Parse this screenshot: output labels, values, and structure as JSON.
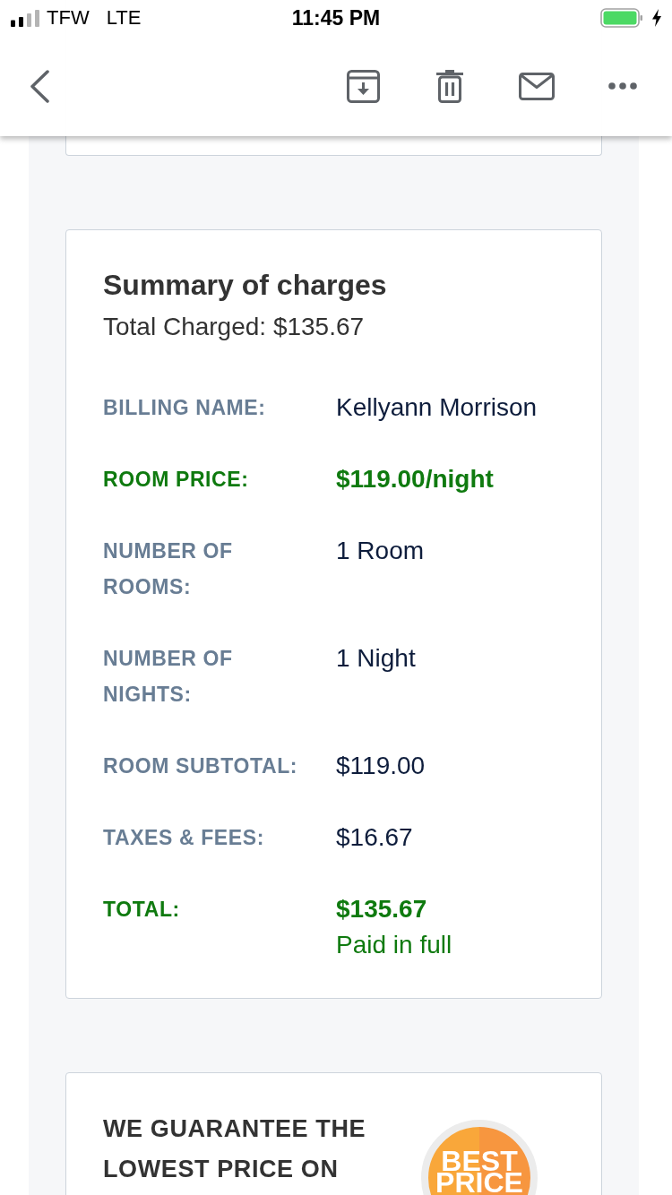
{
  "status_bar": {
    "carrier": "TFW",
    "network": "LTE",
    "time": "11:45 PM",
    "charging": true
  },
  "summary": {
    "title": "Summary of charges",
    "total_charged": "Total Charged: $135.67",
    "rows": [
      {
        "kind": "plain",
        "label": "BILLING NAME:",
        "value": "Kellyann Morrison"
      },
      {
        "kind": "highlight",
        "label": "ROOM PRICE:",
        "value": "$119.00/night"
      },
      {
        "kind": "plain",
        "label": "NUMBER OF ROOMS:",
        "value": "1 Room"
      },
      {
        "kind": "plain",
        "label": "NUMBER OF NIGHTS:",
        "value": "1 Night"
      },
      {
        "kind": "plain",
        "label": "ROOM SUBTOTAL:",
        "value": "$119.00"
      },
      {
        "kind": "plain",
        "label": "TAXES & FEES:",
        "value": "$16.67"
      },
      {
        "kind": "highlight",
        "label": "TOTAL:",
        "value": "$135.67",
        "note": "Paid in full"
      }
    ]
  },
  "guarantee": {
    "heading": "WE GUARANTEE THE LOWEST PRICE ON",
    "badge": "BEST PRICE"
  }
}
